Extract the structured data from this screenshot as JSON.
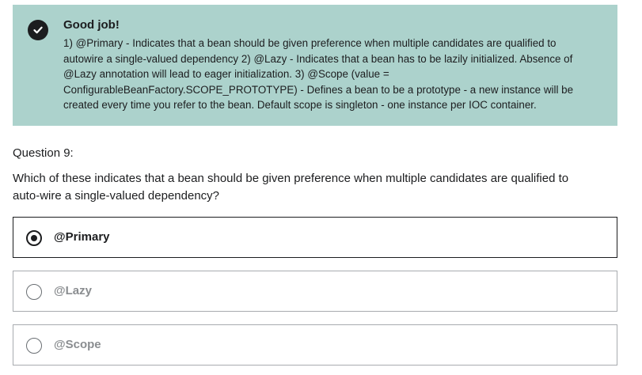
{
  "feedback": {
    "icon": "check-circle-icon",
    "title": "Good job!",
    "lines": [
      "1) @Primary - Indicates that a bean should be given preference when multiple candidates are qualified to",
      "autowire a single-valued dependency 2) @Lazy - Indicates that a bean has to be lazily initialized. Absence of",
      "@Lazy annotation will lead to eager initialization. 3) @Scope (value =",
      "ConfigurableBeanFactory.SCOPE_PROTOTYPE) - Defines a bean to be a prototype - a new instance will be",
      "created every time you refer to the bean. Default scope is singleton - one instance per IOC container."
    ]
  },
  "question": {
    "number_label": "Question 9:",
    "text_lines": [
      "Which of these indicates that a bean should be given preference when multiple candidates are qualified to",
      "auto-wire a single-valued dependency?"
    ]
  },
  "options": [
    {
      "label": "@Primary",
      "selected": true
    },
    {
      "label": "@Lazy",
      "selected": false
    },
    {
      "label": "@Scope",
      "selected": false
    }
  ]
}
